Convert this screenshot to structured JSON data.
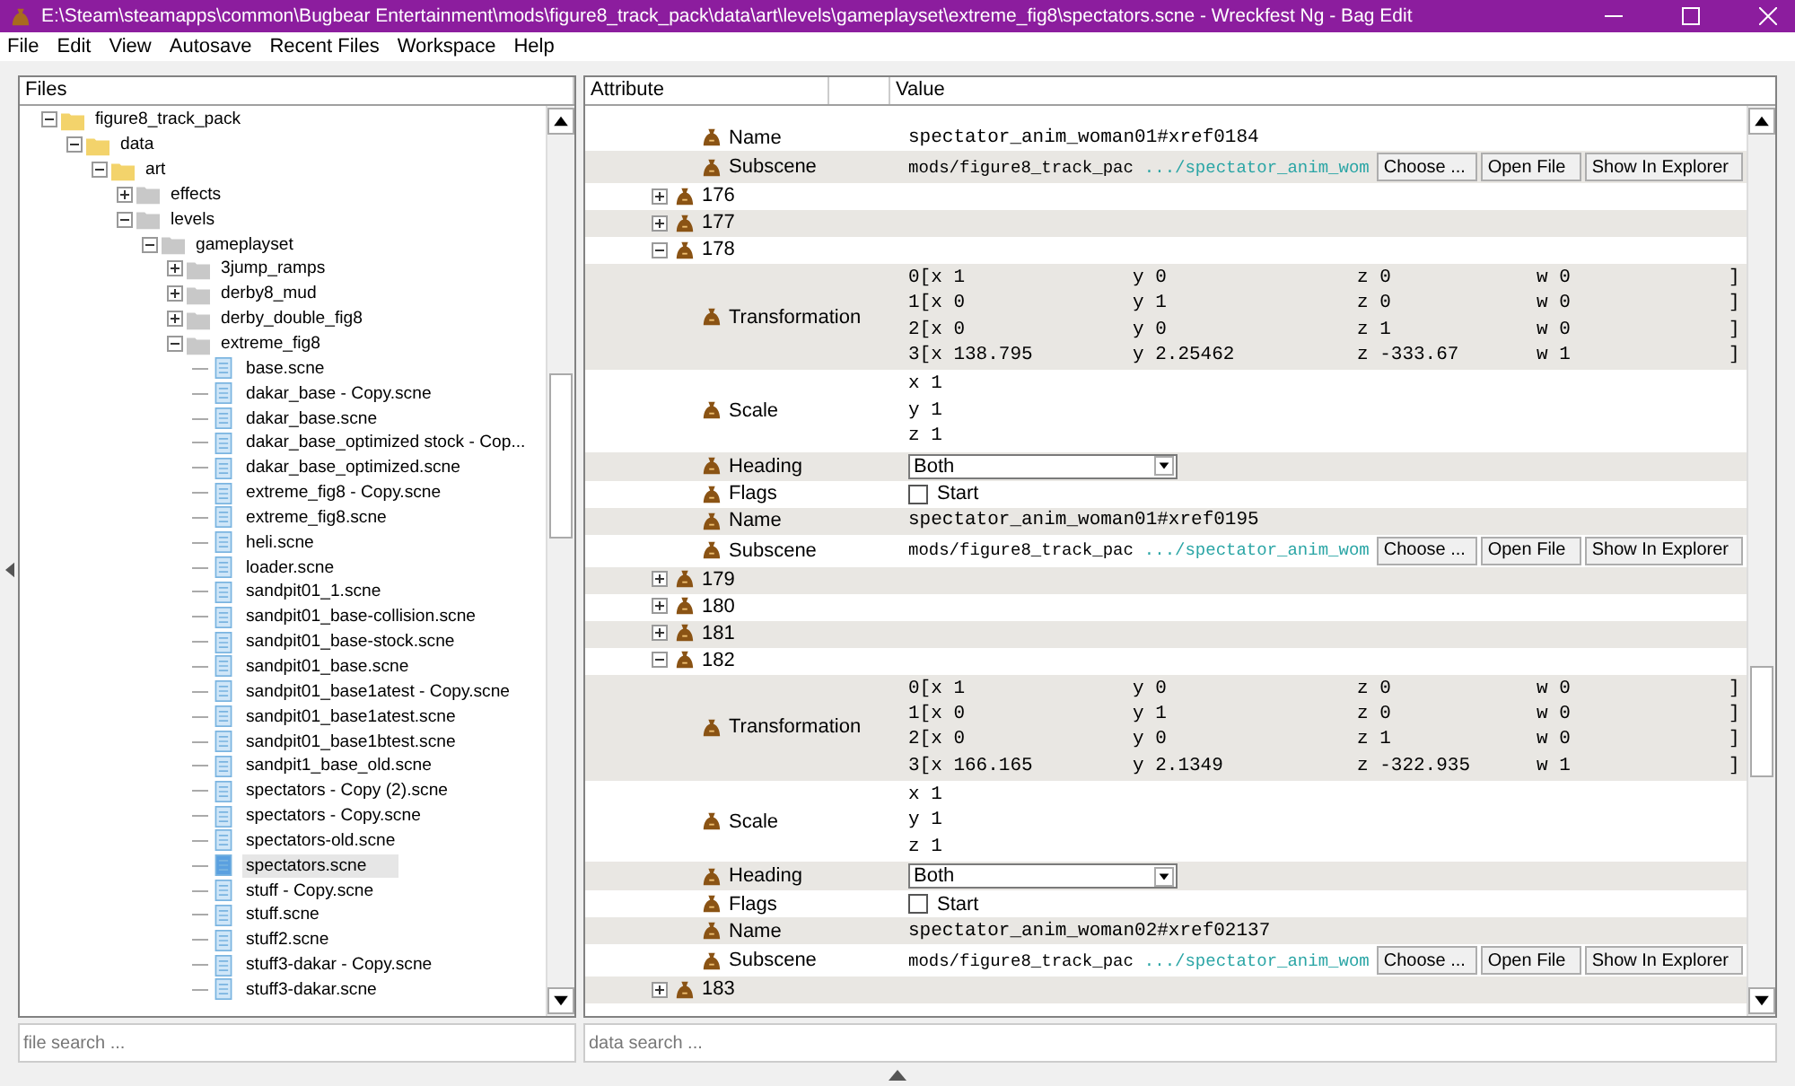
{
  "window": {
    "title": "E:\\Steam\\steamapps\\common\\Bugbear Entertainment\\mods\\figure8_track_pack\\data\\art\\levels\\gameplayset\\extreme_fig8\\spectators.scne - Wreckfest Ng - Bag Edit"
  },
  "menu": [
    "File",
    "Edit",
    "View",
    "Autosave",
    "Recent Files",
    "Workspace",
    "Help"
  ],
  "files_panel": {
    "header": "Files",
    "tree": [
      {
        "label": "figure8_track_pack",
        "kind": "folder",
        "expanded": true,
        "selected": false,
        "children": [
          {
            "label": "data",
            "kind": "folder",
            "expanded": true,
            "selected": false,
            "children": [
              {
                "label": "art",
                "kind": "folder",
                "expanded": true,
                "selected": false,
                "children": [
                  {
                    "label": "effects",
                    "kind": "folder",
                    "expanded": false,
                    "selected": false
                  },
                  {
                    "label": "levels",
                    "kind": "folder",
                    "expanded": true,
                    "selected": false,
                    "children": [
                      {
                        "label": "gameplayset",
                        "kind": "folder",
                        "expanded": true,
                        "selected": false,
                        "children": [
                          {
                            "label": "3jump_ramps",
                            "kind": "folder",
                            "expanded": false,
                            "selected": false
                          },
                          {
                            "label": "derby8_mud",
                            "kind": "folder",
                            "expanded": false,
                            "selected": false
                          },
                          {
                            "label": "derby_double_fig8",
                            "kind": "folder",
                            "expanded": false,
                            "selected": false
                          },
                          {
                            "label": "extreme_fig8",
                            "kind": "folder",
                            "expanded": true,
                            "selected": false,
                            "children": [
                              {
                                "label": "base.scne",
                                "kind": "file",
                                "selected": false
                              },
                              {
                                "label": "dakar_base - Copy.scne",
                                "kind": "file",
                                "selected": false
                              },
                              {
                                "label": "dakar_base.scne",
                                "kind": "file",
                                "selected": false
                              },
                              {
                                "label": "dakar_base_optimized stock - Cop...",
                                "kind": "file",
                                "selected": false
                              },
                              {
                                "label": "dakar_base_optimized.scne",
                                "kind": "file",
                                "selected": false
                              },
                              {
                                "label": "extreme_fig8 - Copy.scne",
                                "kind": "file",
                                "selected": false
                              },
                              {
                                "label": "extreme_fig8.scne",
                                "kind": "file",
                                "selected": false
                              },
                              {
                                "label": "heli.scne",
                                "kind": "file",
                                "selected": false
                              },
                              {
                                "label": "loader.scne",
                                "kind": "file",
                                "selected": false
                              },
                              {
                                "label": "sandpit01_1.scne",
                                "kind": "file",
                                "selected": false
                              },
                              {
                                "label": "sandpit01_base-collision.scne",
                                "kind": "file",
                                "selected": false
                              },
                              {
                                "label": "sandpit01_base-stock.scne",
                                "kind": "file",
                                "selected": false
                              },
                              {
                                "label": "sandpit01_base.scne",
                                "kind": "file",
                                "selected": false
                              },
                              {
                                "label": "sandpit01_base1atest - Copy.scne",
                                "kind": "file",
                                "selected": false
                              },
                              {
                                "label": "sandpit01_base1atest.scne",
                                "kind": "file",
                                "selected": false
                              },
                              {
                                "label": "sandpit01_base1btest.scne",
                                "kind": "file",
                                "selected": false
                              },
                              {
                                "label": "sandpit1_base_old.scne",
                                "kind": "file",
                                "selected": false
                              },
                              {
                                "label": "spectators - Copy (2).scne",
                                "kind": "file",
                                "selected": false
                              },
                              {
                                "label": "spectators - Copy.scne",
                                "kind": "file",
                                "selected": false
                              },
                              {
                                "label": "spectators-old.scne",
                                "kind": "file",
                                "selected": false
                              },
                              {
                                "label": "spectators.scne",
                                "kind": "file",
                                "selected": true
                              },
                              {
                                "label": "stuff - Copy.scne",
                                "kind": "file",
                                "selected": false
                              },
                              {
                                "label": "stuff.scne",
                                "kind": "file",
                                "selected": false
                              },
                              {
                                "label": "stuff2.scne",
                                "kind": "file",
                                "selected": false
                              },
                              {
                                "label": "stuff3-dakar - Copy.scne",
                                "kind": "file",
                                "selected": false
                              },
                              {
                                "label": "stuff3-dakar.scne",
                                "kind": "file",
                                "selected": false
                              }
                            ]
                          }
                        ]
                      }
                    ]
                  }
                ]
              }
            ]
          }
        ]
      }
    ],
    "search": {
      "placeholder": "file search ..."
    }
  },
  "data_panel": {
    "columns": [
      "Attribute",
      "Value"
    ],
    "rows": [
      {
        "kind": "text",
        "name": "Name",
        "value": "spectator_anim_woman01#xref0184"
      },
      {
        "kind": "subscene",
        "name": "Subscene",
        "path": "mods/figure8_track_pac",
        "link": ".../spectator_anim_wom",
        "buttons": [
          "Choose ...",
          "Open File",
          "Show In Explorer"
        ]
      },
      {
        "kind": "node",
        "label": "176",
        "expanded": false
      },
      {
        "kind": "node",
        "label": "177",
        "expanded": false
      },
      {
        "kind": "node",
        "label": "178",
        "expanded": true
      },
      {
        "kind": "matrix",
        "name": "Transformation",
        "lines": [
          [
            "0[x 1",
            "y 0",
            "z 0",
            "w 0",
            "]"
          ],
          [
            "1[x 0",
            "y 1",
            "z 0",
            "w 0",
            "]"
          ],
          [
            "2[x 0",
            "y 0",
            "z 1",
            "w 0",
            "]"
          ],
          [
            "3[x 138.795",
            "y 2.25462",
            "z -333.67",
            "w 1",
            "]"
          ]
        ]
      },
      {
        "kind": "vector",
        "name": "Scale",
        "lines": [
          "x 1",
          "y 1",
          "z 1"
        ]
      },
      {
        "kind": "dropdown",
        "name": "Heading",
        "value": "Both"
      },
      {
        "kind": "checkbox",
        "name": "Flags",
        "label": "Start",
        "checked": false
      },
      {
        "kind": "text",
        "name": "Name",
        "value": "spectator_anim_woman01#xref0195"
      },
      {
        "kind": "subscene",
        "name": "Subscene",
        "path": "mods/figure8_track_pac",
        "link": ".../spectator_anim_wom",
        "buttons": [
          "Choose ...",
          "Open File",
          "Show In Explorer"
        ]
      },
      {
        "kind": "node",
        "label": "179",
        "expanded": false
      },
      {
        "kind": "node",
        "label": "180",
        "expanded": false
      },
      {
        "kind": "node",
        "label": "181",
        "expanded": false
      },
      {
        "kind": "node",
        "label": "182",
        "expanded": true
      },
      {
        "kind": "matrix",
        "name": "Transformation",
        "lines": [
          [
            "0[x 1",
            "y 0",
            "z 0",
            "w 0",
            "]"
          ],
          [
            "1[x 0",
            "y 1",
            "z 0",
            "w 0",
            "]"
          ],
          [
            "2[x 0",
            "y 0",
            "z 1",
            "w 0",
            "]"
          ],
          [
            "3[x 166.165",
            "y 2.1349",
            "z -322.935",
            "w 1",
            "]"
          ]
        ]
      },
      {
        "kind": "vector",
        "name": "Scale",
        "lines": [
          "x 1",
          "y 1",
          "z 1"
        ]
      },
      {
        "kind": "dropdown",
        "name": "Heading",
        "value": "Both"
      },
      {
        "kind": "checkbox",
        "name": "Flags",
        "label": "Start",
        "checked": false
      },
      {
        "kind": "text",
        "name": "Name",
        "value": "spectator_anim_woman02#xref02137"
      },
      {
        "kind": "subscene",
        "name": "Subscene",
        "path": "mods/figure8_track_pac",
        "link": ".../spectator_anim_wom",
        "buttons": [
          "Choose ...",
          "Open File",
          "Show In Explorer"
        ]
      },
      {
        "kind": "node",
        "label": "183",
        "expanded": false
      }
    ],
    "search": {
      "placeholder": "data search ..."
    }
  }
}
